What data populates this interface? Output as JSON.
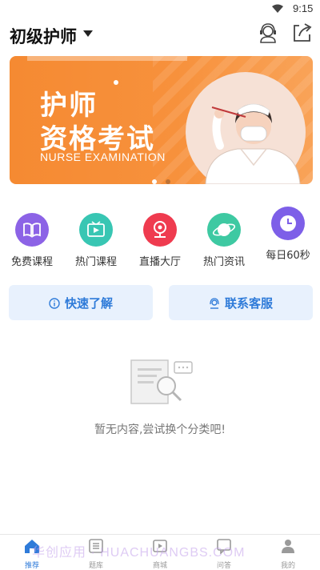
{
  "status_bar": {
    "time": "9:15"
  },
  "header": {
    "title": "初级护师"
  },
  "banner": {
    "line1": "护师",
    "line2": "资格考试",
    "line3": "NURSE EXAMINATION"
  },
  "categories": [
    {
      "label": "免费课程",
      "color": "#8c63e6",
      "icon": "book-icon"
    },
    {
      "label": "热门课程",
      "color": "#38c6b3",
      "icon": "play-icon"
    },
    {
      "label": "直播大厅",
      "color": "#ef3b4f",
      "icon": "webcam-icon"
    },
    {
      "label": "热门资讯",
      "color": "#3ec9a2",
      "icon": "planet-icon"
    },
    {
      "label": "每日60秒",
      "color": "#7d5fe8",
      "icon": "clock-icon"
    }
  ],
  "actions": {
    "quick_learn": "快速了解",
    "contact": "联系客服"
  },
  "empty_state": {
    "message": "暂无内容,尝试换个分类吧!"
  },
  "tabbar": {
    "items": [
      {
        "label": "推荐",
        "active": true
      },
      {
        "label": "题库",
        "active": false
      },
      {
        "label": "商城",
        "active": false
      },
      {
        "label": "问答",
        "active": false
      },
      {
        "label": "我的",
        "active": false
      }
    ]
  },
  "watermark": "华创应用 · HUACHUANGBS.COM",
  "colors": {
    "accent": "#2f7bd9",
    "banner": "#f58a32",
    "button_bg": "#e8f1fd"
  }
}
